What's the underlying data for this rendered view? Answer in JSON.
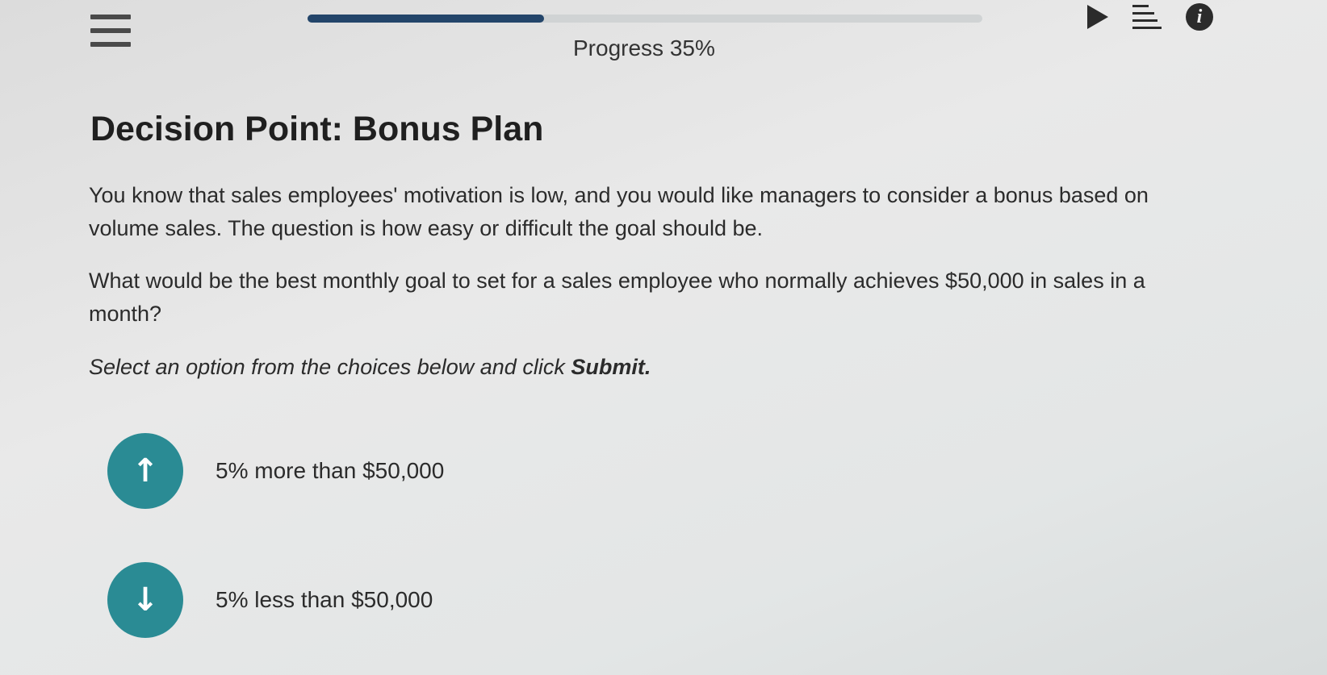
{
  "header": {
    "progress_value": 35,
    "progress_label": "Progress 35%",
    "info_glyph": "i",
    "icons": [
      "menu-icon",
      "play-icon",
      "list-icon",
      "info-icon"
    ]
  },
  "content": {
    "title": "Decision Point: Bonus Plan",
    "paragraph1": "You know that sales employees' motivation is low, and you would like managers to consider a bonus based on volume sales. The question is how easy or difficult the goal should be.",
    "paragraph2": "What would be the best monthly goal to set for a sales employee who normally achieves $50,000 in sales in a month?",
    "instruction_prefix": "Select an option from the choices below and click ",
    "instruction_bold": "Submit."
  },
  "options": [
    {
      "arrow": "↑",
      "icon": "arrow-up-icon",
      "label": "5% more than $50,000"
    },
    {
      "arrow": "↓",
      "icon": "arrow-down-icon",
      "label": "5% less than $50,000"
    }
  ],
  "colors": {
    "accent_teal": "#2a8b94",
    "progress_fill": "#23456a"
  }
}
